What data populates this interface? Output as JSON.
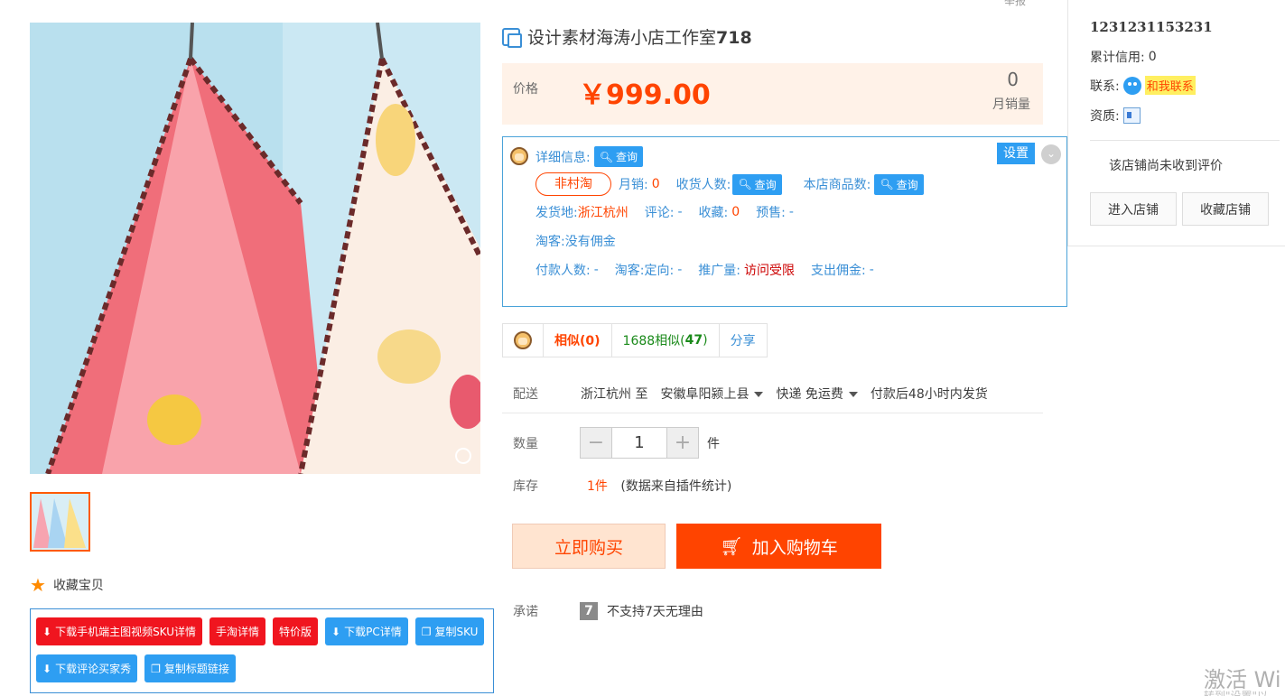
{
  "report_label": "举报",
  "title": {
    "prefix": "设计素材海涛小店工作室",
    "suffix": "718"
  },
  "price": {
    "label": "价格",
    "value": "￥999.00",
    "monthly_sales_count": "0",
    "monthly_sales_label": "月销量"
  },
  "info": {
    "detail_label": "详细信息:",
    "query_label": "查询",
    "settings_label": "设置",
    "tag_label": "非村淘",
    "monthly_label": "月销:",
    "monthly_value": "0",
    "receivers_label": "收货人数:",
    "shop_items_label": "本店商品数:",
    "ship_from_label": "发货地:",
    "ship_from_value": "浙江杭州",
    "comments_label": "评论:",
    "comments_value": "-",
    "favorites_label": "收藏:",
    "favorites_value": "0",
    "presale_label": "预售:",
    "presale_value": "-",
    "taoke_text": "淘客:没有佣金",
    "payers_label": "付款人数:",
    "payers_value": "-",
    "taoke_target_label": "淘客:定向:",
    "taoke_target_value": "-",
    "promo_label": "推广量:",
    "promo_value": "访问受限",
    "commission_label": "支出佣金:",
    "commission_value": "-"
  },
  "tabs": {
    "similar_label": "相似(0)",
    "similar1688_prefix": "1688相似(",
    "similar1688_count": "47",
    "similar1688_suffix": ")",
    "share_label": "分享"
  },
  "delivery": {
    "label": "配送",
    "from": "浙江杭州",
    "to_word": "至",
    "destination": "安徽阜阳颍上县",
    "shipping": "快递 免运费",
    "ship_time": "付款后48小时内发货"
  },
  "quantity": {
    "label": "数量",
    "value": "1",
    "minus": "−",
    "plus": "+",
    "unit": "件"
  },
  "stock": {
    "label": "库存",
    "value": "1件",
    "note": "(数据来自插件统计)"
  },
  "actions": {
    "buy_now": "立即购买",
    "add_to_cart": "加入购物车"
  },
  "promise": {
    "label": "承诺",
    "badge": "7",
    "text": "不支持7天无理由"
  },
  "gallery": {
    "favorite_label": "收藏宝贝"
  },
  "tools": {
    "btn_download_mobile": "下载手机端主图视频SKU详情",
    "btn_mobile_detail": "手淘详情",
    "btn_special": "特价版",
    "btn_download_pc": "下载PC详情",
    "btn_copy_sku": "复制SKU",
    "btn_download_reviews": "下载评论买家秀",
    "btn_copy_title": "复制标题链接"
  },
  "shop": {
    "name": "1231231153231",
    "credit_label": "累计信用:",
    "credit_value": "0",
    "contact_label": "联系:",
    "contact_button": "和我联系",
    "qualification_label": "资质:",
    "no_reviews": "该店铺尚未收到评价",
    "enter_shop": "进入店铺",
    "favorite_shop": "收藏店铺"
  },
  "watermark": {
    "line1": "激活 Wi",
    "line2": "转到\"设置\"以"
  },
  "colors": {
    "accent": "#ff4400",
    "blue": "#2e9ef2",
    "red_button": "#f0151f",
    "price_bg": "#fff2e8"
  }
}
